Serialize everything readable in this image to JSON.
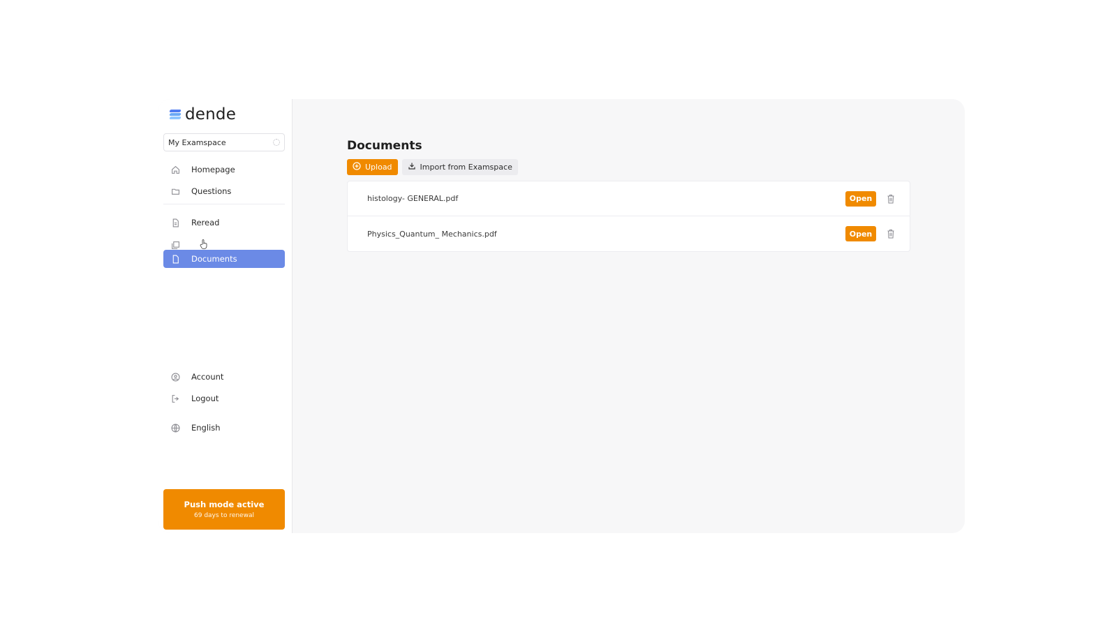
{
  "brand": {
    "name": "dende",
    "colors": {
      "accent": "#f08a00",
      "active_nav": "#6b8ae6",
      "logo": [
        "#4f7bf1",
        "#6aa8f5",
        "#8fc6ff"
      ]
    }
  },
  "workspace": {
    "label": "My Examspace",
    "icon": "gear-icon"
  },
  "sidebar": {
    "items": [
      {
        "label": "Homepage",
        "icon": "home-icon"
      },
      {
        "label": "Questions",
        "icon": "folder-icon"
      },
      {
        "label": "Reread",
        "icon": "document-icon"
      },
      {
        "label": "",
        "icon": "stack-icon"
      },
      {
        "label": "Documents",
        "icon": "file-icon",
        "active": true
      }
    ],
    "bottom_items": [
      {
        "label": "Account",
        "icon": "user-icon"
      },
      {
        "label": "Logout",
        "icon": "logout-icon"
      },
      {
        "label": "English",
        "icon": "globe-icon"
      }
    ],
    "push_banner": {
      "title": "Push mode active",
      "subtitle": "69 days to renewal"
    }
  },
  "main": {
    "title": "Documents",
    "toolbar": {
      "upload_label": "Upload",
      "import_label": "Import from Examspace"
    },
    "documents": [
      {
        "name": "histology- GENERAL.pdf",
        "open_label": "Open"
      },
      {
        "name": "Physics_Quantum_ Mechanics.pdf",
        "open_label": "Open"
      }
    ]
  }
}
